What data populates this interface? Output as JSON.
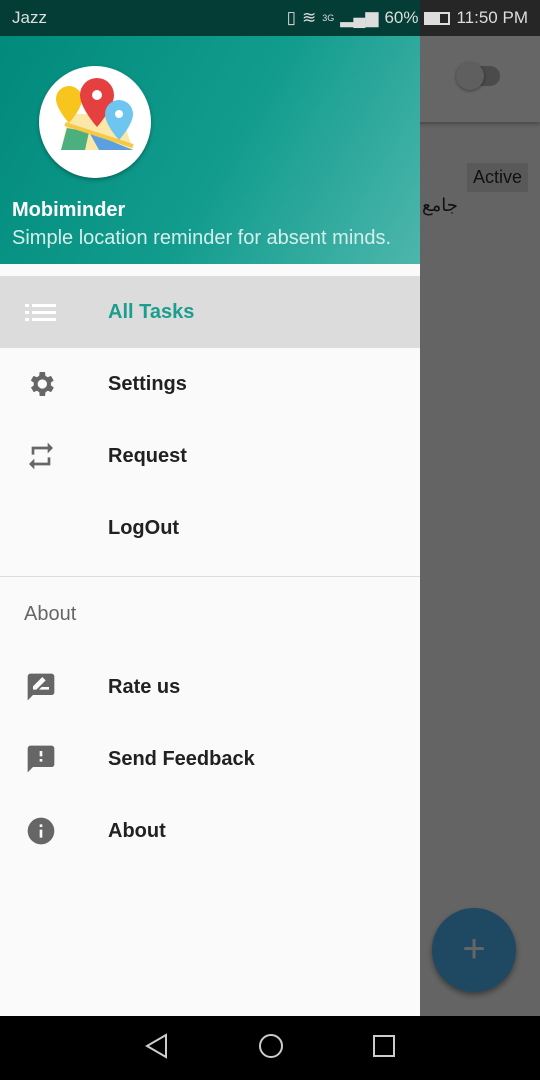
{
  "status_bar": {
    "carrier": "Jazz",
    "network": "3G",
    "battery": "60%",
    "time": "11:50 PM"
  },
  "background": {
    "badge": "Active",
    "task_title": "جامع",
    "fab_label": "+"
  },
  "drawer": {
    "app_name": "Mobiminder",
    "tagline": "Simple location reminder for absent minds.",
    "items": [
      {
        "label": "All Tasks",
        "icon": "list-icon"
      },
      {
        "label": "Settings",
        "icon": "gear-icon"
      },
      {
        "label": "Request",
        "icon": "swap-icon"
      },
      {
        "label": "LogOut",
        "icon": ""
      }
    ],
    "section_title": "About",
    "about_items": [
      {
        "label": "Rate us",
        "icon": "rate-icon"
      },
      {
        "label": "Send Feedback",
        "icon": "feedback-icon"
      },
      {
        "label": "About",
        "icon": "info-icon"
      }
    ]
  },
  "colors": {
    "accent": "#1a9e8f",
    "header": "#00897b",
    "fab": "#4fb3f6"
  }
}
